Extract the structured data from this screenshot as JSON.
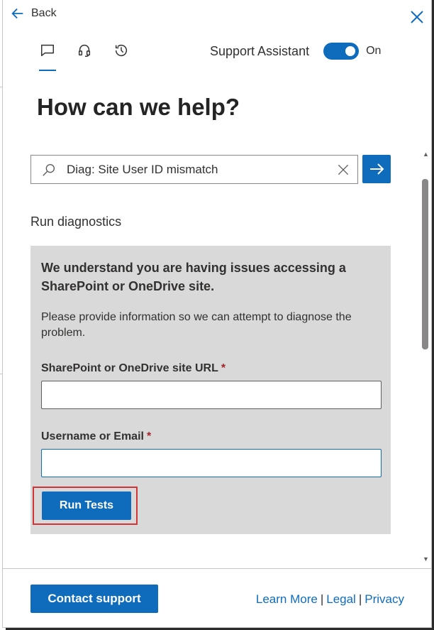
{
  "header": {
    "back_label": "Back",
    "support_assistant_label": "Support Assistant",
    "toggle_state": "On"
  },
  "main": {
    "title": "How can we help?",
    "search": {
      "value": "Diag: Site User ID mismatch"
    },
    "section_title": "Run diagnostics",
    "card": {
      "heading": "We understand you are having issues accessing a SharePoint or OneDrive site.",
      "description": "Please provide information so we can attempt to diagnose the problem.",
      "url_label": "SharePoint or OneDrive site URL",
      "username_label": "Username or Email",
      "required_marker": "*",
      "run_button": "Run Tests"
    }
  },
  "footer": {
    "contact_button": "Contact support",
    "links": [
      "Learn More",
      "Legal",
      "Privacy"
    ],
    "separator": "|"
  },
  "colors": {
    "accent": "#0f6cbd",
    "highlight_box": "#d13438",
    "required": "#a4262c",
    "card_bg": "#d9d9d9"
  }
}
